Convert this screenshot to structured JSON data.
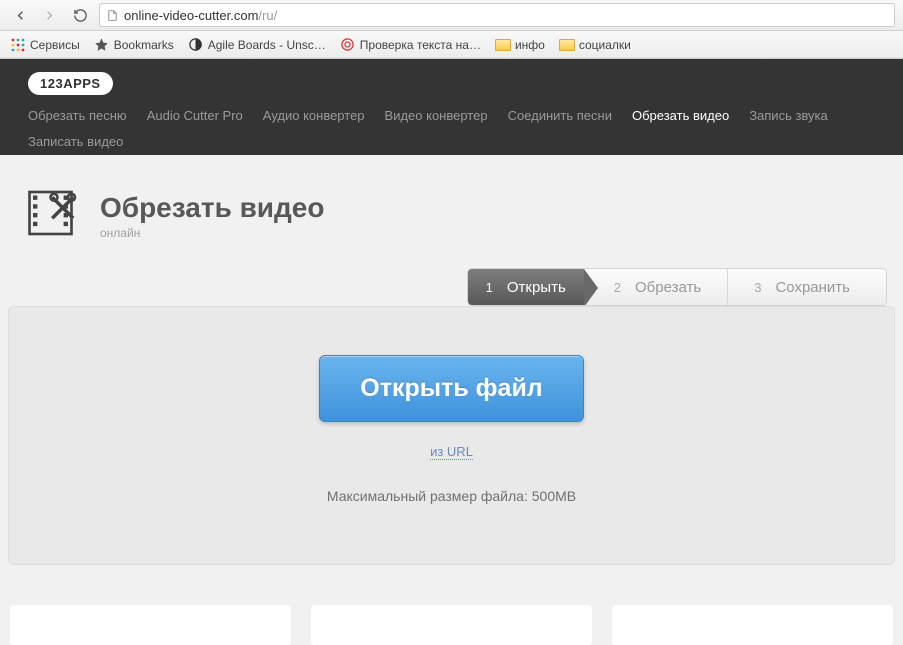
{
  "browser": {
    "url_domain": "online-video-cutter.com",
    "url_path": "/ru/"
  },
  "bookmarks": {
    "services": "Сервисы",
    "bookmarks": "Bookmarks",
    "agile": "Agile Boards - Unsc…",
    "text_check": "Проверка текста на…",
    "info": "инфо",
    "social": "социалки"
  },
  "nav": {
    "logo": "123APPS",
    "links": {
      "trim_song": "Обрезать песню",
      "audio_cutter_pro": "Audio Cutter Pro",
      "audio_converter": "Аудио конвертер",
      "video_converter": "Видео конвертер",
      "join_songs": "Соединить песни",
      "trim_video": "Обрезать видео",
      "record_audio": "Запись звука",
      "record_video": "Записать видео"
    }
  },
  "page": {
    "title": "Обрезать видео",
    "subtitle": "онлайн"
  },
  "steps": {
    "s1_num": "1",
    "s1_label": "Открыть",
    "s2_num": "2",
    "s2_label": "Обрезать",
    "s3_num": "3",
    "s3_label": "Сохранить"
  },
  "card": {
    "open_button": "Открыть файл",
    "url_link": "из URL",
    "max_note": "Максимальный размер файла: 500MB"
  }
}
